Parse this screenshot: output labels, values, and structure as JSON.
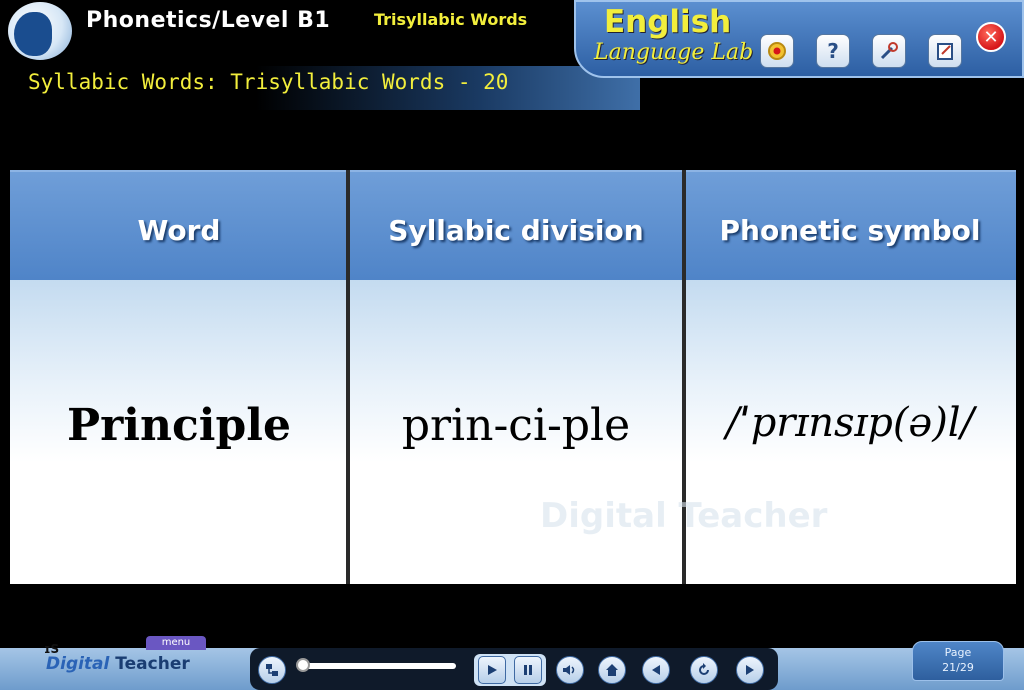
{
  "header": {
    "title": "Phonetics/Level B1",
    "subtitle": "Trisyllabic Words",
    "lesson_title": "Syllabic Words: Trisyllabic Words - 20"
  },
  "brand": {
    "line1": "English",
    "line2": "Language Lab"
  },
  "toolbar": {
    "close_label": "✕",
    "help_label": "?"
  },
  "table": {
    "headers": [
      "Word",
      "Syllabic division",
      "Phonetic symbol"
    ],
    "row": [
      "Principle",
      "prin-ci-ple",
      "/ˈprɪnsɪp(ə)l/"
    ]
  },
  "watermark": "Digital Teacher",
  "footer": {
    "menu_label": "menu",
    "logo_prefix": "ɪS",
    "logo_part1": "Digital",
    "logo_part2": "Teacher",
    "page_label": "Page",
    "page_value": "21/29"
  },
  "colors": {
    "accent_yellow": "#f2ee3c",
    "header_blue": "#4f84c8",
    "close_red": "#d6161a"
  }
}
